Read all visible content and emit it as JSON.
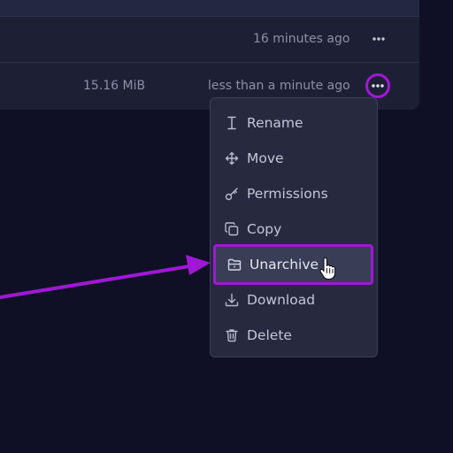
{
  "files": {
    "rows": [
      {
        "size": "",
        "modified": "16 minutes ago"
      },
      {
        "size": "15.16 MiB",
        "modified": "less than a minute ago"
      }
    ]
  },
  "menu": {
    "items": [
      {
        "label": "Rename",
        "icon": "text-cursor-icon"
      },
      {
        "label": "Move",
        "icon": "move-arrows-icon"
      },
      {
        "label": "Permissions",
        "icon": "key-icon"
      },
      {
        "label": "Copy",
        "icon": "copy-icon"
      },
      {
        "label": "Unarchive",
        "icon": "folder-open-icon"
      },
      {
        "label": "Download",
        "icon": "download-icon"
      },
      {
        "label": "Delete",
        "icon": "trash-icon"
      }
    ],
    "highlighted": "Unarchive"
  },
  "colors": {
    "background": "#0f1026",
    "panel": "#1d2035",
    "menu": "#272a3f",
    "annotation": "#a117d6"
  }
}
